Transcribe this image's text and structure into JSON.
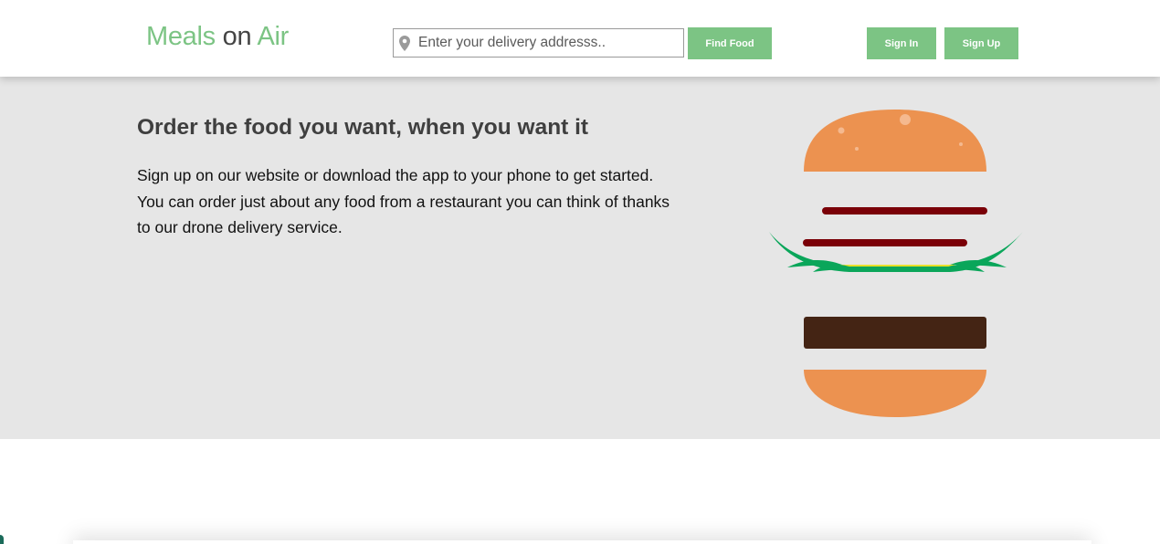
{
  "header": {
    "logo": {
      "part1": "Meals",
      "part2": "on",
      "part3": "Air"
    },
    "search": {
      "placeholder": "Enter your delivery addresss..",
      "value": ""
    },
    "find_button": "Find Food",
    "signin_button": "Sign In",
    "signup_button": "Sign Up"
  },
  "hero": {
    "title": "Order the food you want, when you want it",
    "text_lines": [
      "Sign up on our website or download the app to your phone to get started.",
      "You can order just about any food from a restaurant you can think of thanks",
      "to our drone delivery service."
    ],
    "illustration": "burger-illustration"
  },
  "colors": {
    "brand_green": "#7cc484",
    "logo_dark": "#444444",
    "hero_bg": "#e6e6e6",
    "bun": "#ec9250",
    "tomato": "#7a0007",
    "lettuce": "#0aa65a",
    "cheese": "#e8e02a",
    "patty": "#442414"
  }
}
